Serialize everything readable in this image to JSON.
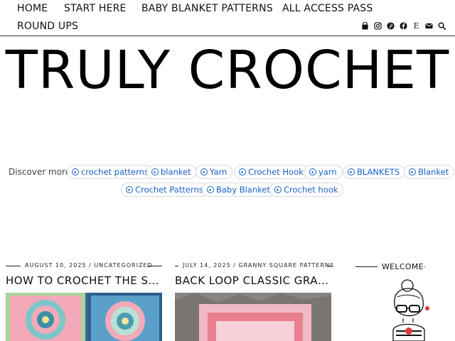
{
  "nav": {
    "items": [
      "HOME",
      "START HERE",
      "BABY BLANKET PATTERNS",
      "ALL ACCESS PASS",
      "ROUND UPS"
    ],
    "social_icons": [
      "shopping-bag-icon",
      "instagram-icon",
      "pinterest-icon",
      "facebook-icon",
      "etsy-icon",
      "email-icon",
      "search-icon"
    ],
    "etsy_glyph": "E"
  },
  "logo": {
    "text": "TRULY CROCHET"
  },
  "discover": {
    "label": "Discover more",
    "chips": [
      "crochet patterns",
      "blanket",
      "Yarn",
      "Crochet Hook",
      "yarn",
      "BLANKETS",
      "Blanket",
      "Crochet Patterns",
      "Baby Blanket",
      "Crochet hook"
    ]
  },
  "posts": [
    {
      "date": "AUGUST 10, 2025",
      "separator": "/",
      "category": "UNCATEGORIZED",
      "title": "HOW TO CROCHET THE SUNB..."
    },
    {
      "date": "JULY 14, 2025",
      "separator": "/",
      "category": "GRANNY SQUARE PATTERNS",
      "title": "BACK LOOP CLASSIC GRANNY ..."
    }
  ],
  "sidebar": {
    "welcome_title": "WELCOME"
  },
  "colors": {
    "chip_text": "#1a62c8",
    "chip_border": "#d6dbe3",
    "text": "#111111"
  }
}
